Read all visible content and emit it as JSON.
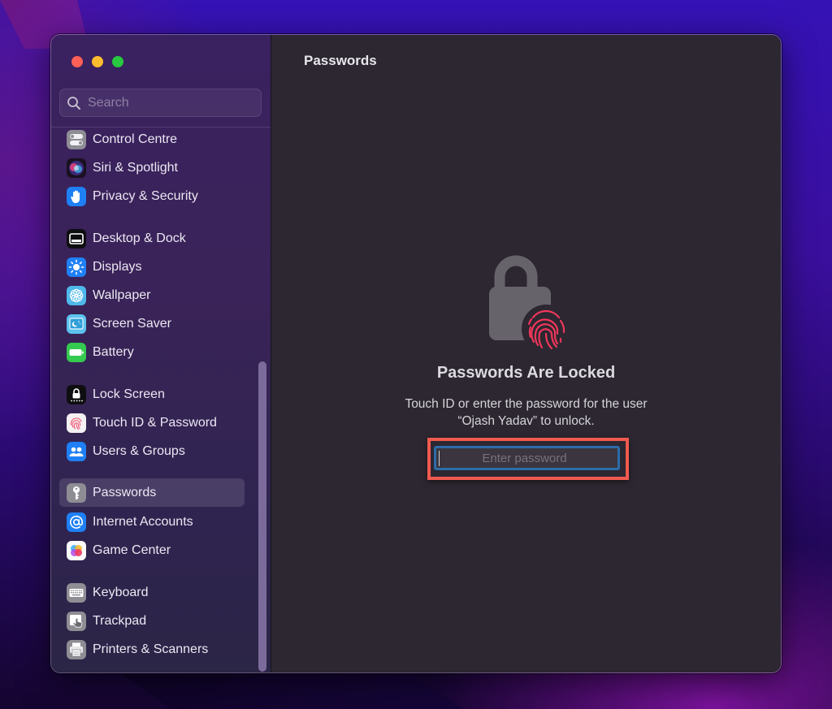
{
  "window": {
    "title": "Passwords",
    "controls": [
      "close",
      "minimize",
      "zoom"
    ]
  },
  "sidebar": {
    "search_placeholder": "Search",
    "search_value": "",
    "items": [
      {
        "label": "Control Centre",
        "icon": "control-centre-icon",
        "selected": false
      },
      {
        "label": "Siri & Spotlight",
        "icon": "siri-icon",
        "selected": false
      },
      {
        "label": "Privacy & Security",
        "icon": "hand-icon",
        "selected": false
      },
      {
        "label": "Desktop & Dock",
        "icon": "dock-icon",
        "selected": false
      },
      {
        "label": "Displays",
        "icon": "sun-icon",
        "selected": false
      },
      {
        "label": "Wallpaper",
        "icon": "flower-icon",
        "selected": false
      },
      {
        "label": "Screen Saver",
        "icon": "screen-saver-icon",
        "selected": false
      },
      {
        "label": "Battery",
        "icon": "battery-icon",
        "selected": false
      },
      {
        "label": "Lock Screen",
        "icon": "lock-screen-icon",
        "selected": false
      },
      {
        "label": "Touch ID & Password",
        "icon": "fingerprint-icon",
        "selected": false
      },
      {
        "label": "Users & Groups",
        "icon": "users-icon",
        "selected": false
      },
      {
        "label": "Passwords",
        "icon": "key-icon",
        "selected": true
      },
      {
        "label": "Internet Accounts",
        "icon": "at-sign-icon",
        "selected": false
      },
      {
        "label": "Game Center",
        "icon": "game-center-icon",
        "selected": false
      },
      {
        "label": "Keyboard",
        "icon": "keyboard-icon",
        "selected": false
      },
      {
        "label": "Trackpad",
        "icon": "trackpad-icon",
        "selected": false
      },
      {
        "label": "Printers & Scanners",
        "icon": "printer-icon",
        "selected": false
      }
    ]
  },
  "main": {
    "title": "Passwords",
    "locked_title": "Passwords Are Locked",
    "locked_desc_line1": "Touch ID or enter the password for the user",
    "locked_desc_line2": "“Ojash Yadav” to unlock.",
    "password_placeholder": "Enter password",
    "password_value": ""
  },
  "colors": {
    "accent_focus": "#2e6ca8",
    "highlight_annotation": "#f05a4f",
    "fingerprint": "#f0365a"
  }
}
